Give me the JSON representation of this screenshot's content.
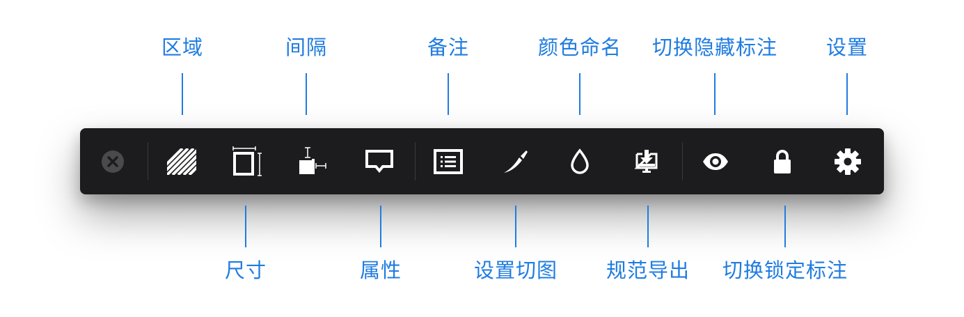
{
  "labels": {
    "area": "区域",
    "size": "尺寸",
    "spacing": "间隔",
    "properties": "属性",
    "notes": "备注",
    "slice": "设置切图",
    "color_naming": "颜色命名",
    "export": "规范导出",
    "toggle_hide": "切换隐藏标注",
    "toggle_lock": "切换锁定标注",
    "settings": "设置"
  },
  "icons": {
    "close": "close-circle-icon",
    "area": "hatched-area-icon",
    "size": "dimension-box-icon",
    "spacing": "spacing-measure-icon",
    "properties": "speech-bubble-icon",
    "notes": "list-note-icon",
    "slice": "knife-slice-icon",
    "color": "droplet-icon",
    "export": "download-export-icon",
    "hide": "eye-icon",
    "lock": "padlock-icon",
    "settings": "gear-icon"
  },
  "colors": {
    "accent": "#1f7ce0",
    "toolbar": "#1c1c1e",
    "icon": "#ffffff"
  }
}
